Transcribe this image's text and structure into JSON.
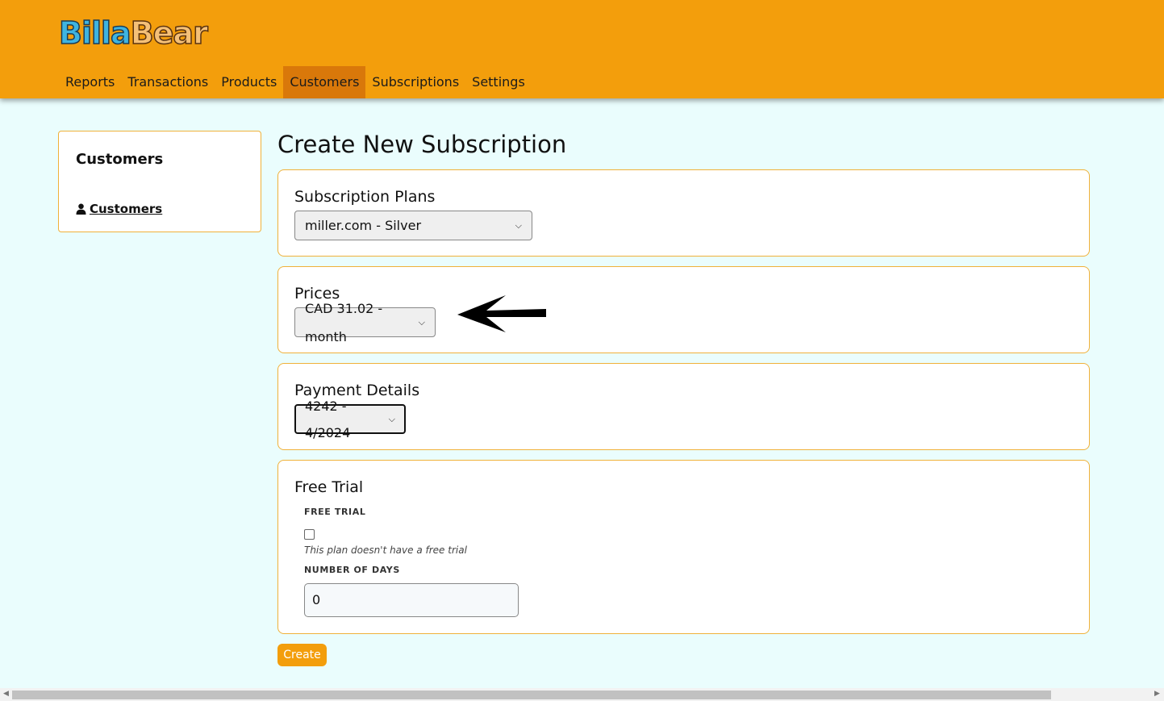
{
  "app": {
    "logo_part1": "Billa",
    "logo_part2": "Bear",
    "nav": [
      "Reports",
      "Transactions",
      "Products",
      "Customers",
      "Subscriptions",
      "Settings"
    ],
    "active_nav": "Customers"
  },
  "sidebar": {
    "title": "Customers",
    "link_label": "Customers",
    "link_icon": "user-icon"
  },
  "main": {
    "title": "Create New Subscription",
    "subscription_plans": {
      "label": "Subscription Plans",
      "selected": "miller.com - Silver"
    },
    "prices": {
      "label": "Prices",
      "selected": "CAD 31.02 - month"
    },
    "payment_details": {
      "label": "Payment Details",
      "selected": "4242 - 4/2024"
    },
    "free_trial": {
      "title": "Free Trial",
      "checkbox_label": "FREE TRIAL",
      "checked": false,
      "hint": "This plan doesn't have a free trial",
      "days_label": "NUMBER OF DAYS",
      "days_value": "0"
    },
    "create_label": "Create"
  },
  "colors": {
    "header": "#f39e0c",
    "active_nav": "#d9780a",
    "background": "#eafdfd",
    "card_border": "#f0b13a",
    "button": "#f39e0c"
  }
}
